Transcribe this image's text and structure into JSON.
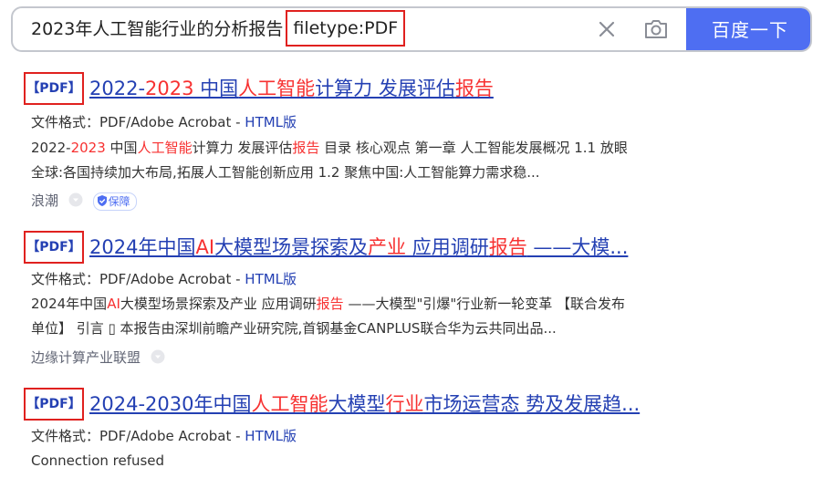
{
  "search": {
    "query_prefix": "2023年人工智能行业的分析报告",
    "query_filetype": "filetype:PDF",
    "button_label": "百度一下"
  },
  "results": [
    {
      "tag": "【PDF】",
      "title_parts": [
        "2022-",
        "2023",
        " 中国",
        "人工智能",
        "计算力 发展评估",
        "报告"
      ],
      "meta_prefix": "文件格式：PDF/Adobe Acrobat - ",
      "meta_link": "HTML版",
      "snippet_line1_parts": [
        "2022-",
        "2023",
        " 中国",
        "人工智能",
        "计算力 发展评估",
        "报告",
        " 目录 核心观点 第一章 人工智能发展概况 1.1 放眼"
      ],
      "snippet_line2": "全球:各国持续加大布局,拓展人工智能创新应用 1.2 聚焦中国:人工智能算力需求稳...",
      "source": "浪潮",
      "badge": "保障"
    },
    {
      "tag": "【PDF】",
      "title_parts": [
        "2024年中国",
        "AI",
        "大模型场景探索及",
        "产业",
        " 应用调研",
        "报告",
        " ——大模..."
      ],
      "meta_prefix": "文件格式：PDF/Adobe Acrobat - ",
      "meta_link": "HTML版",
      "snippet_line1_parts": [
        "2024年中国",
        "AI",
        "大模型场景探索及产业 应用调研",
        "报告",
        " ——大模型\"引爆\"行业新一轮变革 【联合发布"
      ],
      "snippet_line2": "单位】 引言 ▯ 本报告由深圳前瞻产业研究院,首钢基金CANPLUS联合华为云共同出品...",
      "source": "边缘计算产业联盟"
    },
    {
      "tag": "【PDF】",
      "title_parts": [
        "2024-2030年中国",
        "人工智能",
        "大模型",
        "行业",
        "市场运营态 势及发展趋..."
      ],
      "meta_prefix": "文件格式：PDF/Adobe Acrobat - ",
      "meta_link": "HTML版",
      "extra_line": "Connection refused"
    }
  ],
  "colors": {
    "accent": "#4e6ef2",
    "link": "#2440b3",
    "highlight": "#f73131",
    "annotation_box": "#e0211f"
  },
  "icons": [
    "clear-icon",
    "camera-icon",
    "dropdown-circle-icon",
    "shield-check-icon"
  ]
}
